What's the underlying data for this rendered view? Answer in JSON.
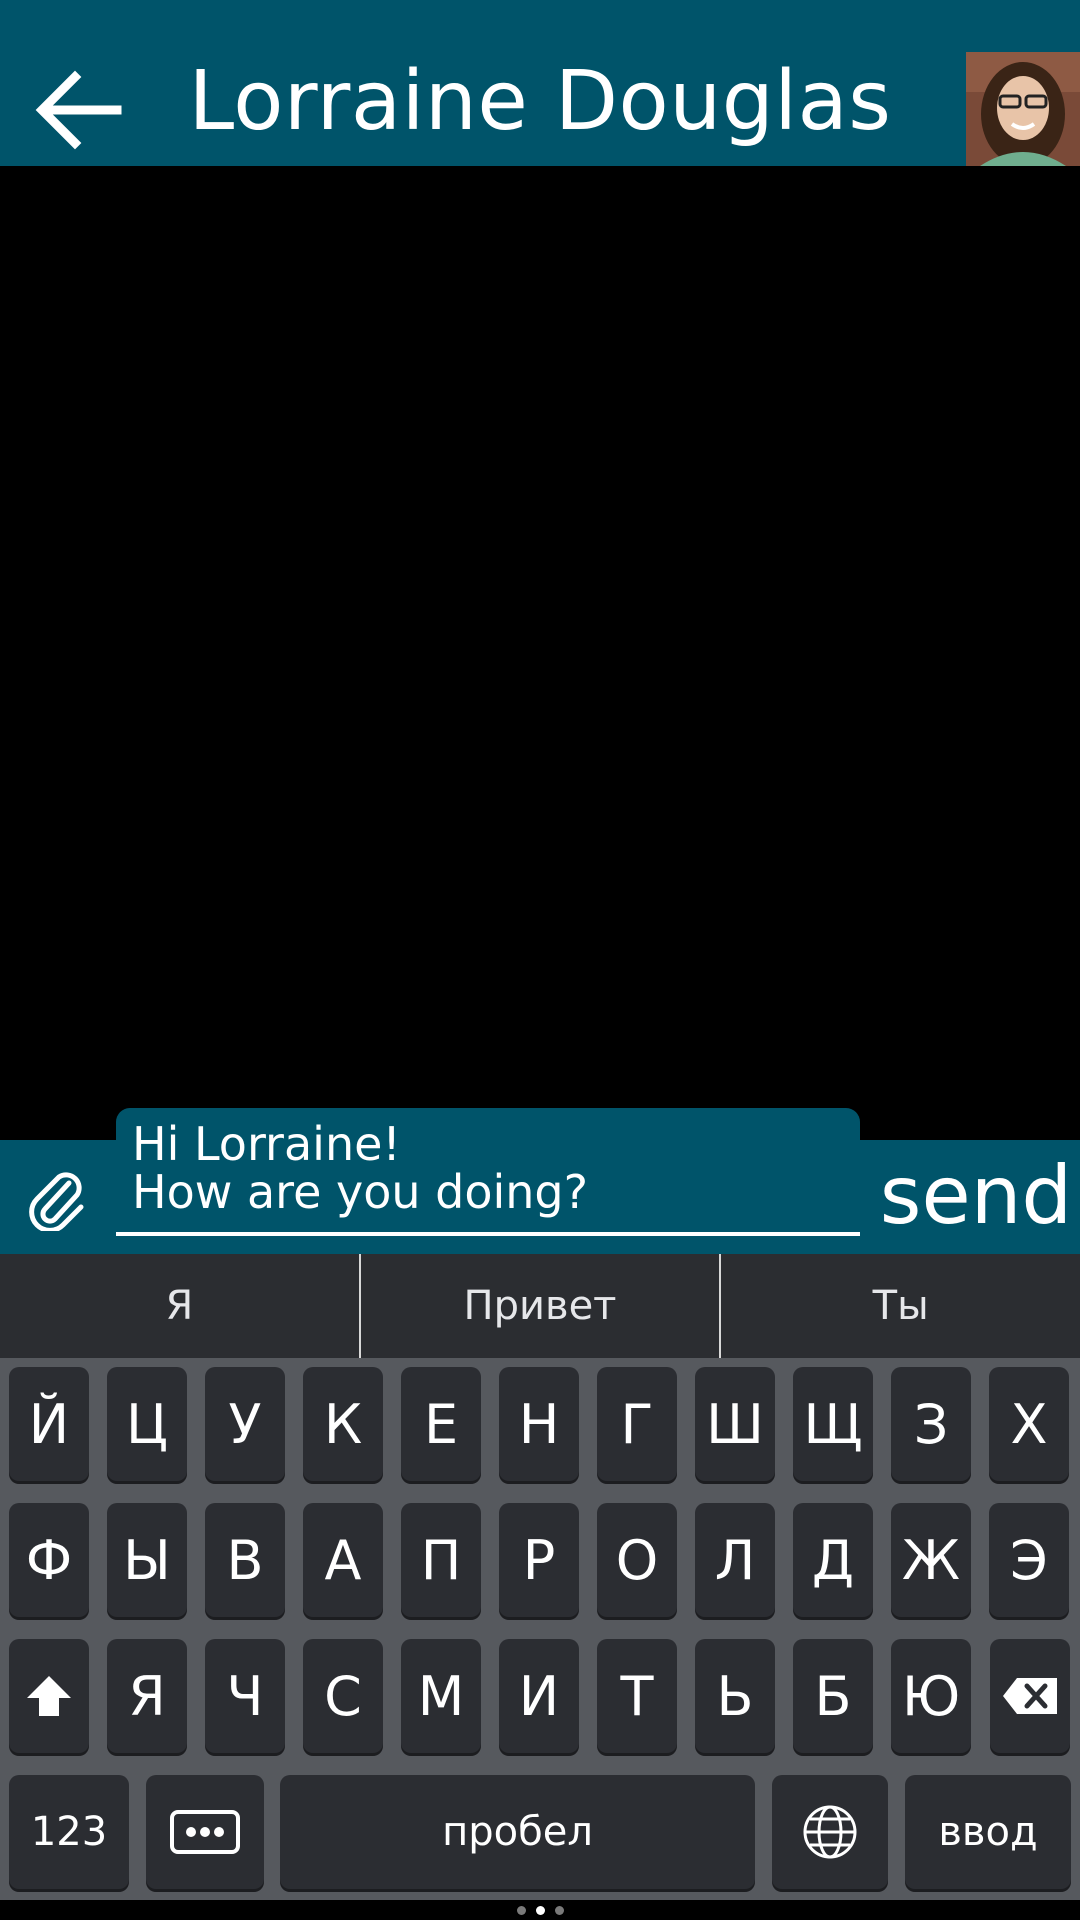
{
  "header": {
    "title": "Lorraine Douglas",
    "back_icon": "arrow-left-icon",
    "avatar": "contact-avatar"
  },
  "compose": {
    "attach_icon": "paperclip-icon",
    "line1": "Hi Lorraine!",
    "line2": "How are you doing?",
    "send_label": "send"
  },
  "suggestions": [
    "Я",
    "Привет",
    "Ты"
  ],
  "keyboard": {
    "row1": [
      "Й",
      "Ц",
      "У",
      "К",
      "Е",
      "Н",
      "Г",
      "Ш",
      "Щ",
      "З",
      "Х"
    ],
    "row2": [
      "Ф",
      "Ы",
      "В",
      "А",
      "П",
      "Р",
      "О",
      "Л",
      "Д",
      "Ж",
      "Э"
    ],
    "row3": [
      "Я",
      "Ч",
      "С",
      "М",
      "И",
      "Т",
      "Ь",
      "Б",
      "Ю"
    ],
    "shift_icon": "shift-icon",
    "backspace_icon": "backspace-icon",
    "numbers_label": "123",
    "emoji_icon": "ellipsis-icon",
    "space_label": "пробел",
    "globe_icon": "globe-icon",
    "return_label": "ввод"
  },
  "colors": {
    "accent": "#00546a",
    "keyboard_bg": "#56595e",
    "key_bg": "#2b2d32"
  },
  "page_indicator": {
    "count": 3,
    "active": 2
  }
}
